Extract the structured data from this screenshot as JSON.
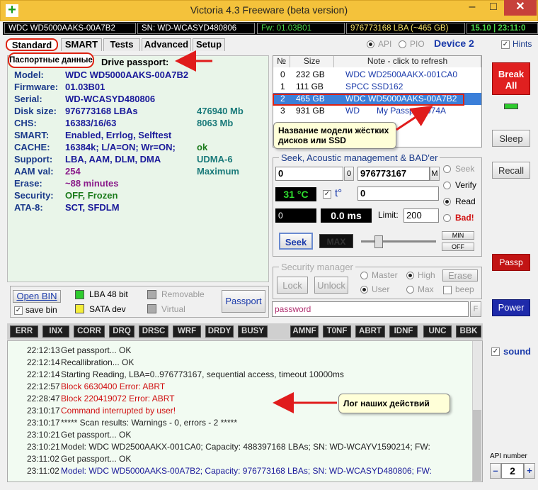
{
  "window": {
    "title": "Victoria 4.3 Freeware (beta version)",
    "min": "–",
    "max": "□",
    "close": "✕"
  },
  "infobar": {
    "model": "WDC WD5000AAKS-00A7B2",
    "sn": "SN: WD-WCASYD480806",
    "fw": "Fw: 01.03B01",
    "lba": "976773168 LBA (~465 GB)",
    "time": "15.10 | 23:11:0"
  },
  "tabs": [
    "Standard",
    "SMART",
    "Tests",
    "Advanced",
    "Setup"
  ],
  "mode": {
    "api": "API",
    "pio": "PIO",
    "device": "Device 2",
    "hints": "Hints"
  },
  "passport": {
    "callout": "Паспортные данные",
    "header": "Drive passport:",
    "rows": [
      {
        "label": "Model:",
        "value": "WDC WD5000AAKS-00A7B2",
        "extra": ""
      },
      {
        "label": "Firmware:",
        "value": "01.03B01",
        "extra": ""
      },
      {
        "label": "Serial:",
        "value": "WD-WCASYD480806",
        "extra": ""
      },
      {
        "label": "Disk size:",
        "value": "976773168 LBAs",
        "extra": "476940 Mb"
      },
      {
        "label": "CHS:",
        "value": "16383/16/63",
        "extra": "8063 Mb"
      },
      {
        "label": "SMART:",
        "value": "Enabled, Errlog, Selftest",
        "extra": ""
      },
      {
        "label": "CACHE:",
        "value": "16384k; L/A=ON; Wr=ON;",
        "extra": "ok"
      },
      {
        "label": "Support:",
        "value": "LBA, AAM, DLM, DMA",
        "extra": "UDMA-6"
      },
      {
        "label": "AAM val:",
        "value": "254",
        "extra": "Maximum"
      },
      {
        "label": "Erase:",
        "value": "~88 minutes",
        "extra": ""
      },
      {
        "label": "Security:",
        "value": "OFF, Frozen",
        "extra": ""
      },
      {
        "label": "ATA-8:",
        "value": "SCT, SFDLM",
        "extra": ""
      }
    ],
    "colors": {
      "extra": "#1a7a7a",
      "aam": "#8a1a8a",
      "erase": "#8a1a8a",
      "security": "#1a7a1a",
      "cache_ok": "#1a7a1a",
      "support": "#1a7a7a"
    }
  },
  "bottom_left": {
    "open_bin": "Open BIN",
    "save_bin": "save bin",
    "lba48": "LBA 48 bit",
    "sata": "SATA dev",
    "removable": "Removable",
    "virtual": "Virtual",
    "passport_btn": "Passport"
  },
  "drives": {
    "headers": [
      "№",
      "Size",
      "Note - click to refresh"
    ],
    "rows": [
      {
        "n": "0",
        "size": "232 GB",
        "note": "WDC WD2500AAKX-001CA0",
        "note2": ""
      },
      {
        "n": "1",
        "size": "111 GB",
        "note": "SPCC SSD162",
        "note2": ""
      },
      {
        "n": "2",
        "size": "465 GB",
        "note": "WDC WD5000AAKS-00A7B2",
        "note2": ""
      },
      {
        "n": "3",
        "size": "931 GB",
        "note": "WD",
        "note2": "My Passport 074A"
      }
    ],
    "callout": "Название модели жёстких дисков или SSD"
  },
  "seek": {
    "title": "Seek, Acoustic management & BAD'er",
    "start": "0",
    "start_btn": "0",
    "end": "976773167",
    "end_btn": "M",
    "temp": "31 °C",
    "temp_label": "t°",
    "field2": "0",
    "lba_field": "0",
    "ms": "0.0 ms",
    "limit_label": "Limit:",
    "limit": "200",
    "seek_btn": "Seek",
    "max_display": "MAX",
    "min_btn": "MIN",
    "off_btn": "OFF",
    "opts": [
      "Seek",
      "Verify",
      "Read",
      "Bad!"
    ]
  },
  "security": {
    "title": "Security manager",
    "lock": "Lock",
    "unlock": "Unlock",
    "master": "Master",
    "user": "User",
    "high": "High",
    "max": "Max",
    "erase": "Erase",
    "beep": "beep",
    "password": "password",
    "f_btn": "F"
  },
  "right": {
    "break_all": "Break All",
    "sleep": "Sleep",
    "recall": "Recall",
    "passp": "Passp",
    "power": "Power",
    "sound": "sound",
    "api_number_label": "API number",
    "api_number": "2",
    "minus": "–",
    "plus": "+"
  },
  "err_buttons": [
    "ERR",
    "INX",
    "CORR",
    "DRQ",
    "DRSC",
    "WRF",
    "DRDY",
    "BUSY",
    "AMNF",
    "T0NF",
    "ABRT",
    "IDNF",
    "UNC",
    "BBK"
  ],
  "log": {
    "callout": "Лог наших действий",
    "entries": [
      {
        "time": "22:12:13",
        "msg": "Get passport... OK",
        "color": "#222222"
      },
      {
        "time": "22:12:14",
        "msg": "Recallibration... OK",
        "color": "#222222"
      },
      {
        "time": "22:12:14",
        "msg": "Starting Reading, LBA=0..976773167, sequential access, timeout 10000ms",
        "color": "#222222"
      },
      {
        "time": "22:12:57",
        "msg": "Block 6630400 Error: ABRT",
        "color": "#d01010"
      },
      {
        "time": "22:28:47",
        "msg": "Block 220419072 Error: ABRT",
        "color": "#d01010"
      },
      {
        "time": "23:10:17",
        "msg": "Command interrupted by user!",
        "color": "#d01010"
      },
      {
        "time": "23:10:17",
        "msg": "***** Scan results: Warnings - 0, errors - 2 *****",
        "color": "#222222"
      },
      {
        "time": "23:10:21",
        "msg": "Get passport... OK",
        "color": "#222222"
      },
      {
        "time": "23:10:21",
        "msg": "Model: WDC WD2500AAKX-001CA0; Capacity: 488397168 LBAs; SN: WD-WCAYV1590214; FW:",
        "color": "#222222"
      },
      {
        "time": "23:11:02",
        "msg": "Get passport... OK",
        "color": "#222222"
      },
      {
        "time": "23:11:02",
        "msg": "Model: WDC WD5000AAKS-00A7B2; Capacity: 976773168 LBAs; SN: WD-WCASYD480806; FW:",
        "color": "#1a1a9a"
      }
    ]
  }
}
